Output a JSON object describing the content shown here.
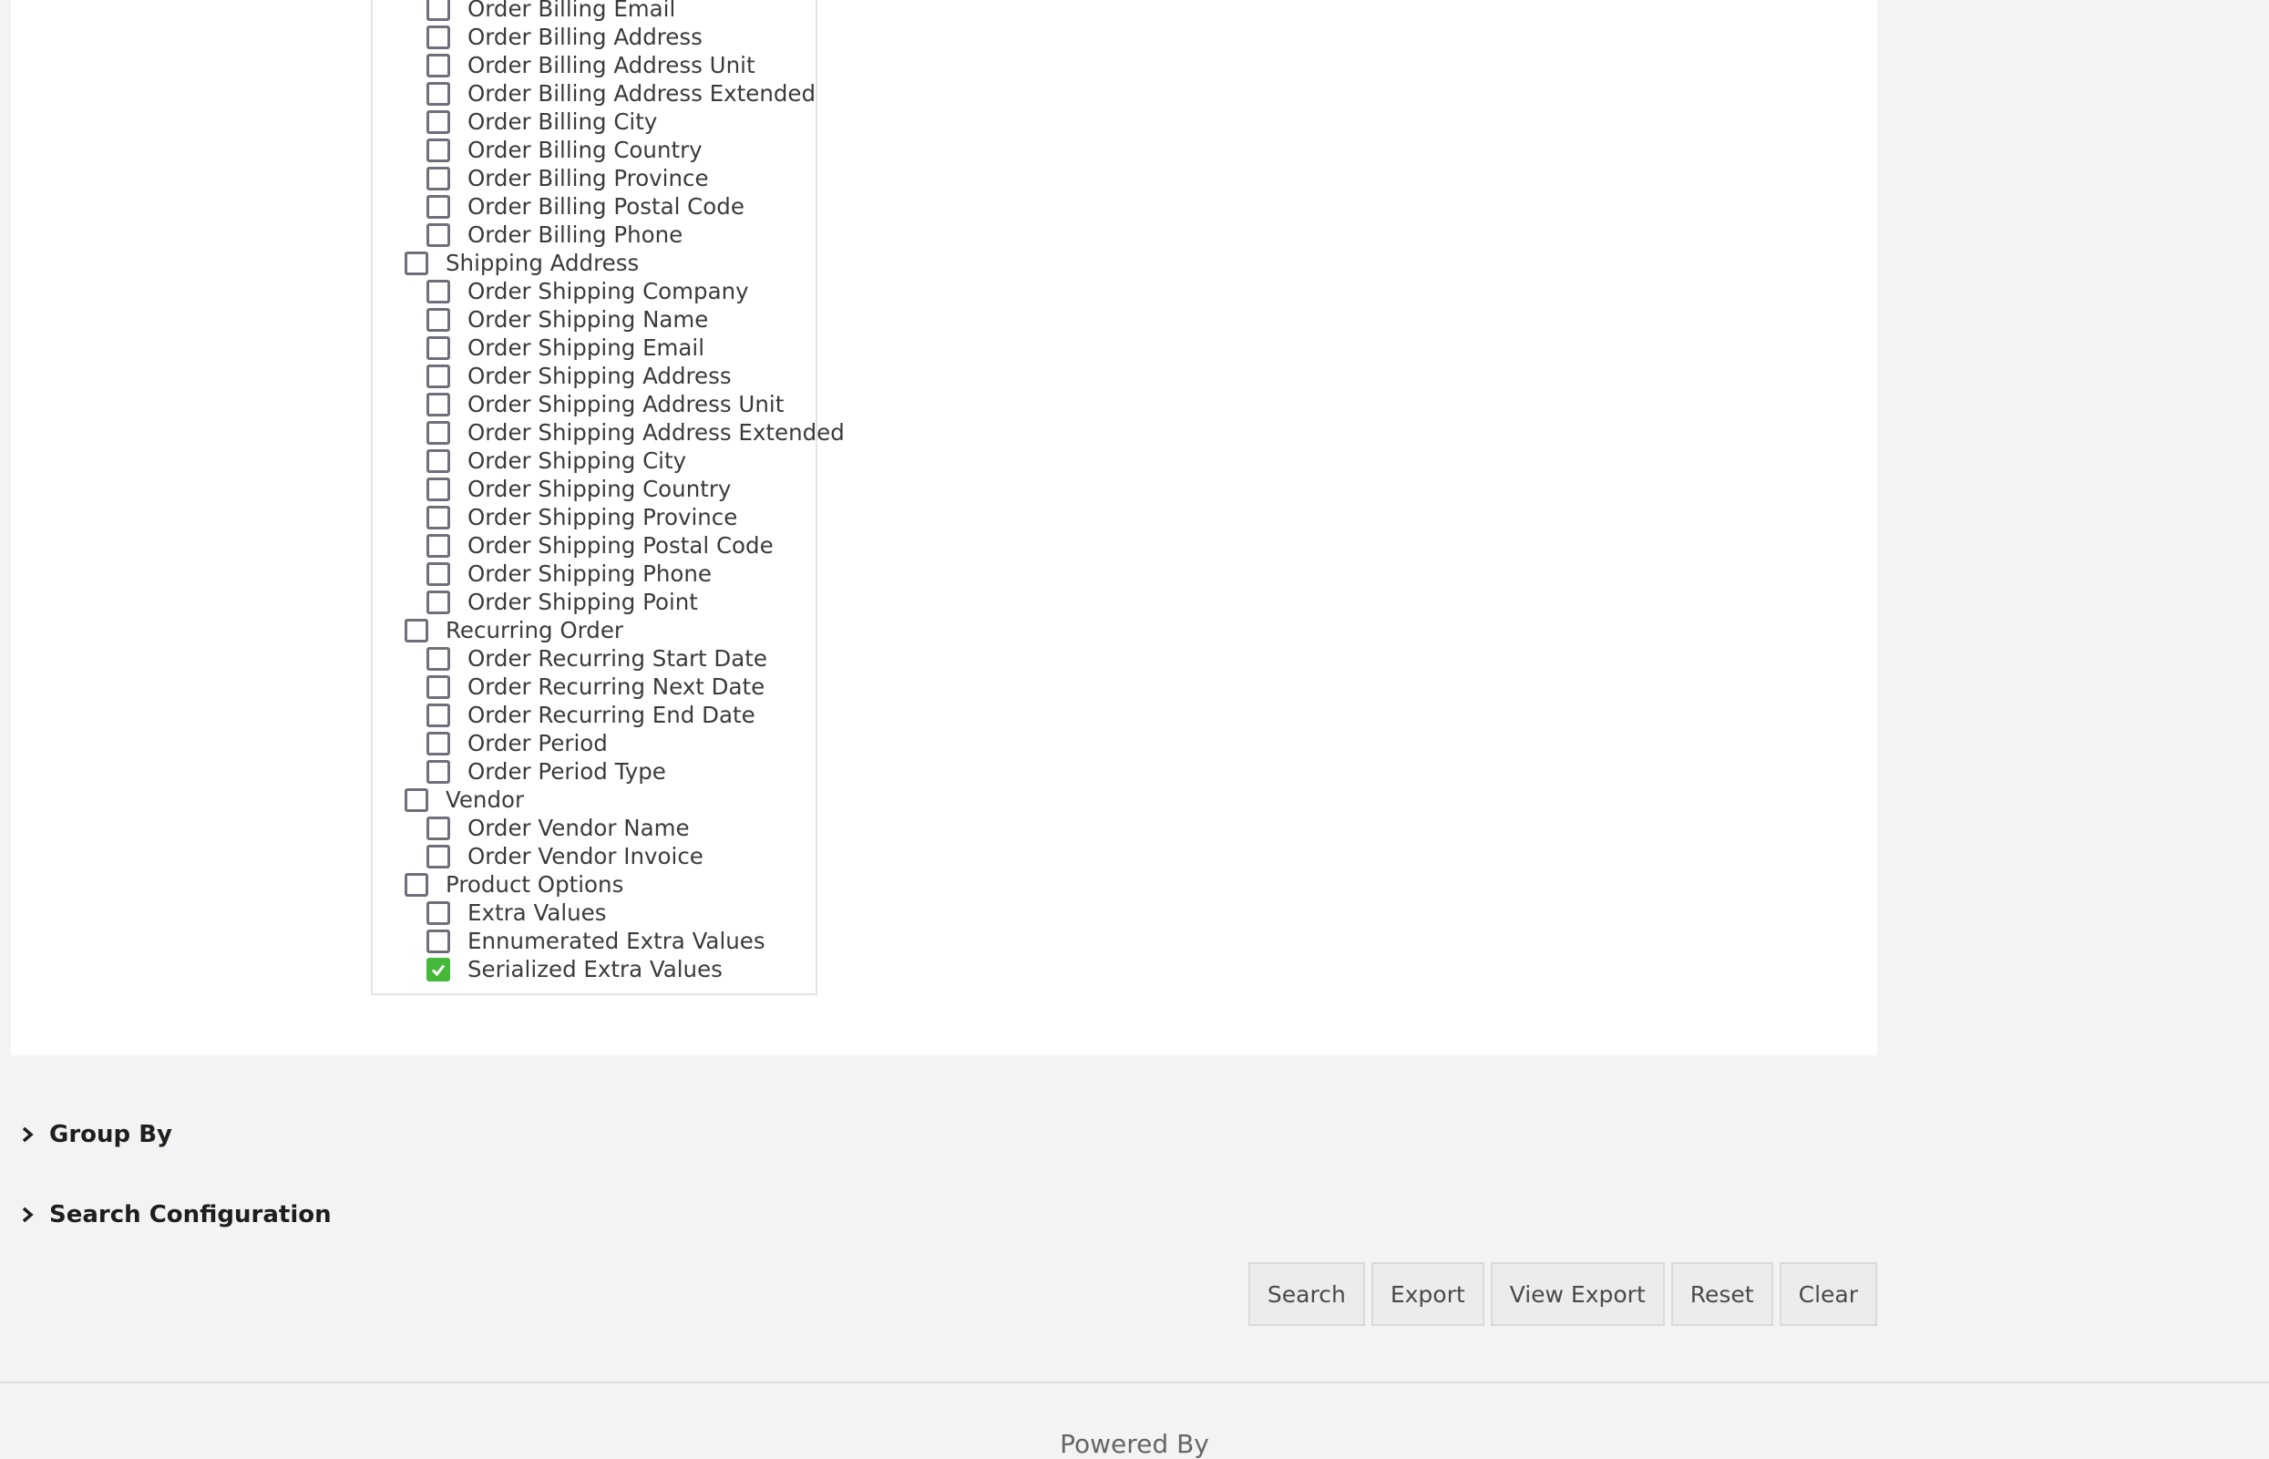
{
  "column_tree": [
    {
      "level": 2,
      "label": "Order Billing Email",
      "checked": false
    },
    {
      "level": 2,
      "label": "Order Billing Address",
      "checked": false
    },
    {
      "level": 2,
      "label": "Order Billing Address Unit",
      "checked": false
    },
    {
      "level": 2,
      "label": "Order Billing Address Extended",
      "checked": false
    },
    {
      "level": 2,
      "label": "Order Billing City",
      "checked": false
    },
    {
      "level": 2,
      "label": "Order Billing Country",
      "checked": false
    },
    {
      "level": 2,
      "label": "Order Billing Province",
      "checked": false
    },
    {
      "level": 2,
      "label": "Order Billing Postal Code",
      "checked": false
    },
    {
      "level": 2,
      "label": "Order Billing Phone",
      "checked": false
    },
    {
      "level": 1,
      "label": "Shipping Address",
      "checked": false
    },
    {
      "level": 2,
      "label": "Order Shipping Company",
      "checked": false
    },
    {
      "level": 2,
      "label": "Order Shipping Name",
      "checked": false
    },
    {
      "level": 2,
      "label": "Order Shipping Email",
      "checked": false
    },
    {
      "level": 2,
      "label": "Order Shipping Address",
      "checked": false
    },
    {
      "level": 2,
      "label": "Order Shipping Address Unit",
      "checked": false
    },
    {
      "level": 2,
      "label": "Order Shipping Address Extended",
      "checked": false
    },
    {
      "level": 2,
      "label": "Order Shipping City",
      "checked": false
    },
    {
      "level": 2,
      "label": "Order Shipping Country",
      "checked": false
    },
    {
      "level": 2,
      "label": "Order Shipping Province",
      "checked": false
    },
    {
      "level": 2,
      "label": "Order Shipping Postal Code",
      "checked": false
    },
    {
      "level": 2,
      "label": "Order Shipping Phone",
      "checked": false
    },
    {
      "level": 2,
      "label": "Order Shipping Point",
      "checked": false
    },
    {
      "level": 1,
      "label": "Recurring Order",
      "checked": false
    },
    {
      "level": 2,
      "label": "Order Recurring Start Date",
      "checked": false
    },
    {
      "level": 2,
      "label": "Order Recurring Next Date",
      "checked": false
    },
    {
      "level": 2,
      "label": "Order Recurring End Date",
      "checked": false
    },
    {
      "level": 2,
      "label": "Order Period",
      "checked": false
    },
    {
      "level": 2,
      "label": "Order Period Type",
      "checked": false
    },
    {
      "level": 1,
      "label": "Vendor",
      "checked": false
    },
    {
      "level": 2,
      "label": "Order Vendor Name",
      "checked": false
    },
    {
      "level": 2,
      "label": "Order Vendor Invoice",
      "checked": false
    },
    {
      "level": 1,
      "label": "Product Options",
      "checked": false
    },
    {
      "level": 2,
      "label": "Extra Values",
      "checked": false
    },
    {
      "level": 2,
      "label": "Ennumerated Extra Values",
      "checked": false
    },
    {
      "level": 2,
      "label": "Serialized Extra Values",
      "checked": true
    }
  ],
  "sections": {
    "group_by": {
      "label": "Group By",
      "icon": "chevron-right-icon"
    },
    "search_configuration": {
      "label": "Search Configuration",
      "icon": "chevron-right-icon"
    }
  },
  "actions": {
    "search": "Search",
    "export": "Export",
    "view_export": "View Export",
    "reset": "Reset",
    "clear": "Clear"
  },
  "footer": {
    "text": "Powered By"
  },
  "colors": {
    "checked": "#45b93a",
    "checkbox_border": "#6f6f7a",
    "page_bg": "#f3f3f5"
  }
}
